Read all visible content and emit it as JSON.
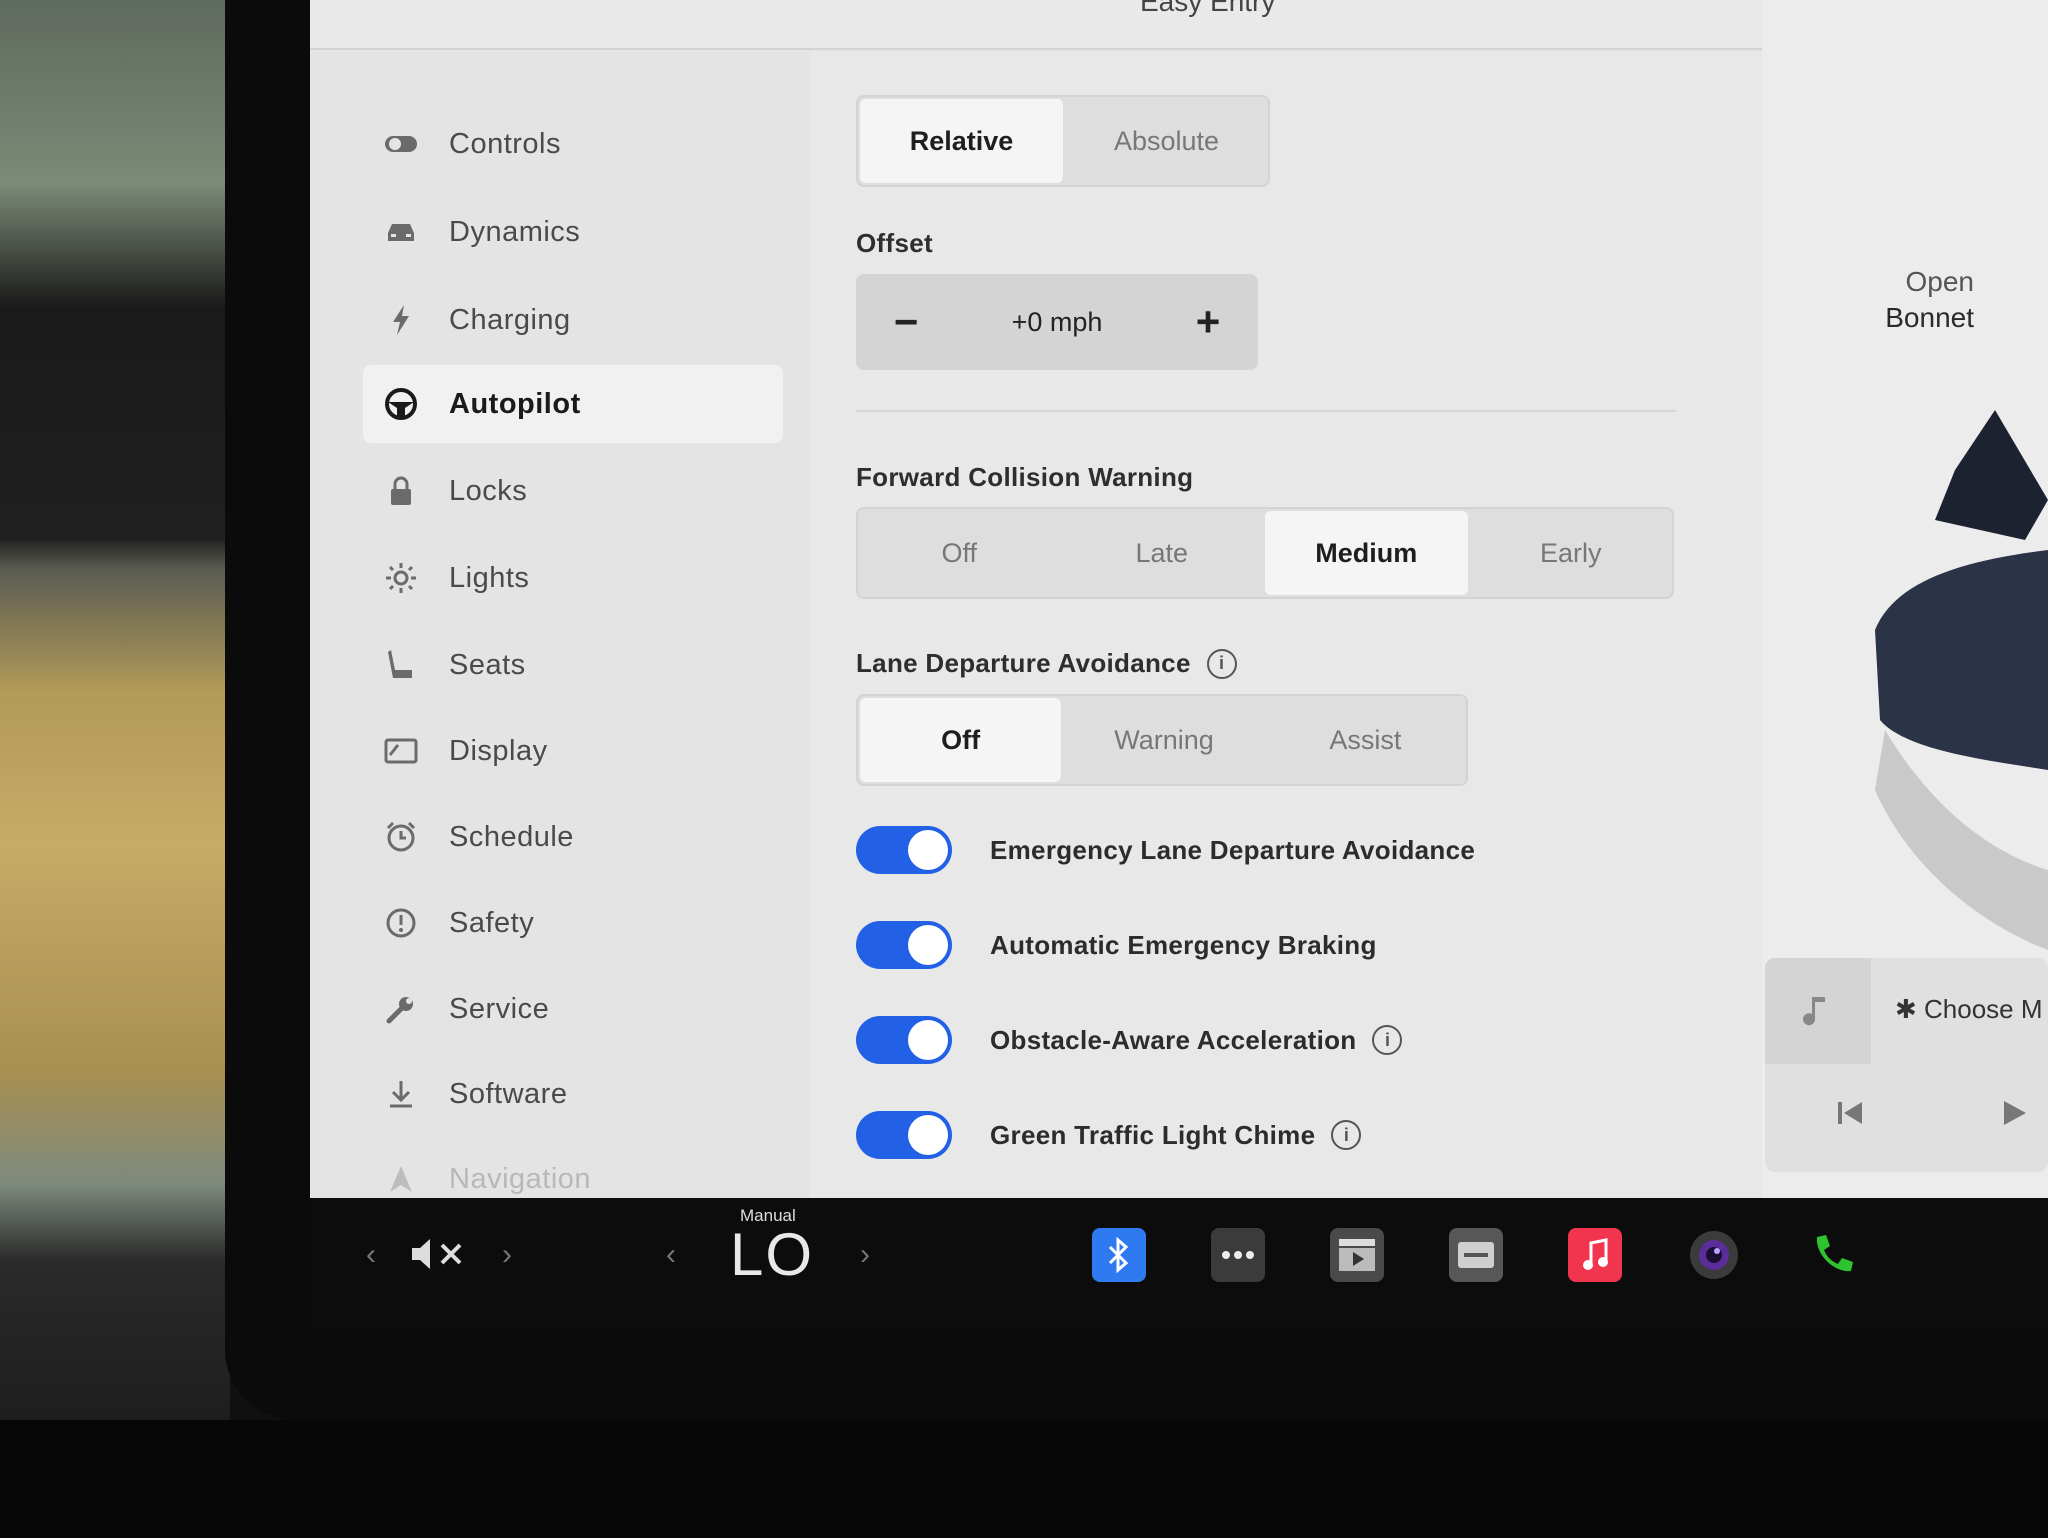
{
  "topbar": {
    "partial_label": "Easy Entry"
  },
  "sidebar": {
    "items": [
      {
        "label": "Controls"
      },
      {
        "label": "Dynamics"
      },
      {
        "label": "Charging"
      },
      {
        "label": "Autopilot"
      },
      {
        "label": "Locks"
      },
      {
        "label": "Lights"
      },
      {
        "label": "Seats"
      },
      {
        "label": "Display"
      },
      {
        "label": "Schedule"
      },
      {
        "label": "Safety"
      },
      {
        "label": "Service"
      },
      {
        "label": "Software"
      },
      {
        "label": "Navigation"
      }
    ],
    "active": "Autopilot"
  },
  "speed_limit": {
    "options": [
      "Relative",
      "Absolute"
    ],
    "selected": "Relative"
  },
  "offset": {
    "label": "Offset",
    "value": "+0 mph",
    "minus": "−",
    "plus": "+"
  },
  "fcw": {
    "label": "Forward Collision Warning",
    "options": [
      "Off",
      "Late",
      "Medium",
      "Early"
    ],
    "selected": "Medium"
  },
  "lda": {
    "label": "Lane Departure Avoidance",
    "info": "i",
    "options": [
      "Off",
      "Warning",
      "Assist"
    ],
    "selected": "Off"
  },
  "toggles": [
    {
      "label": "Emergency Lane Departure Avoidance",
      "on": true,
      "info": false
    },
    {
      "label": "Automatic Emergency Braking",
      "on": true,
      "info": false
    },
    {
      "label": "Obstacle-Aware Acceleration",
      "on": true,
      "info": true
    },
    {
      "label": "Green Traffic Light Chime",
      "on": true,
      "info": true
    }
  ],
  "right_pane": {
    "bonnet_line1": "Open",
    "bonnet_line2": "Bonnet",
    "music_choose": "✱ Choose M"
  },
  "taskbar": {
    "climate_mode": "Manual",
    "temperature": "LO",
    "volume_icon": "speaker-muted-icon",
    "apps": [
      "bluetooth-icon",
      "more-icon",
      "theater-icon",
      "toybox-icon",
      "music-icon",
      "camera-icon",
      "phone-icon"
    ]
  },
  "colors": {
    "accent_blue": "#2260e6",
    "screen_bg": "#e6e6e6",
    "music_red": "#f2354f",
    "phone_green": "#2fc22f"
  }
}
